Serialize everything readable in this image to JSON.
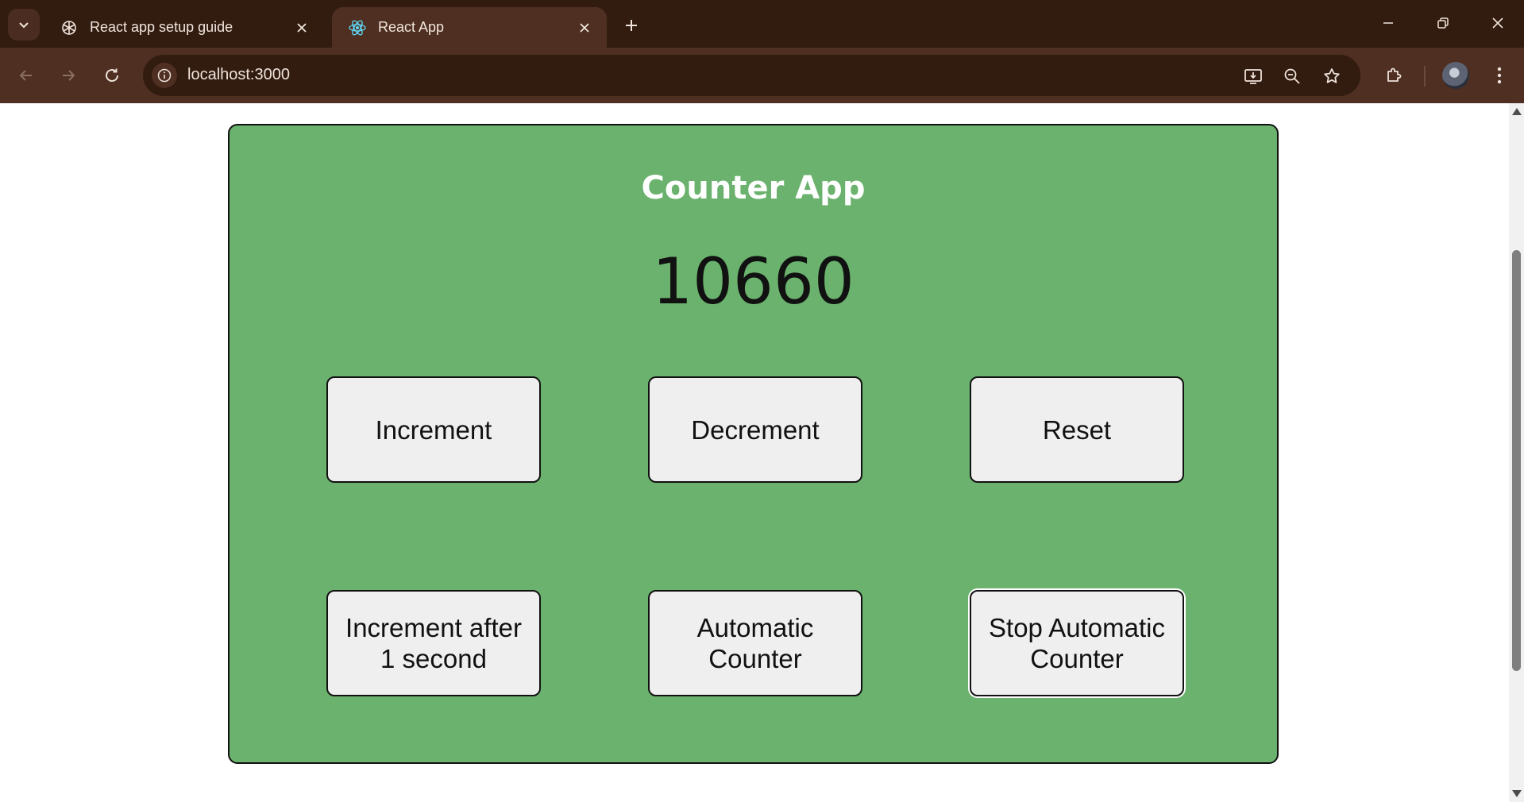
{
  "browser": {
    "tabs": [
      {
        "title": "React app setup guide",
        "active": false,
        "icon": "openai-icon"
      },
      {
        "title": "React App",
        "active": true,
        "icon": "react-icon"
      }
    ],
    "url": "localhost:3000"
  },
  "app": {
    "title": "Counter App",
    "counter": "10660",
    "buttons": {
      "increment": "Increment",
      "decrement": "Decrement",
      "reset": "Reset",
      "increment_delayed": "Increment after 1 second",
      "automatic": "Automatic Counter",
      "stop_automatic": "Stop Automatic Counter"
    },
    "colors": {
      "panel": "#6ab26d",
      "button": "#efefef"
    }
  }
}
